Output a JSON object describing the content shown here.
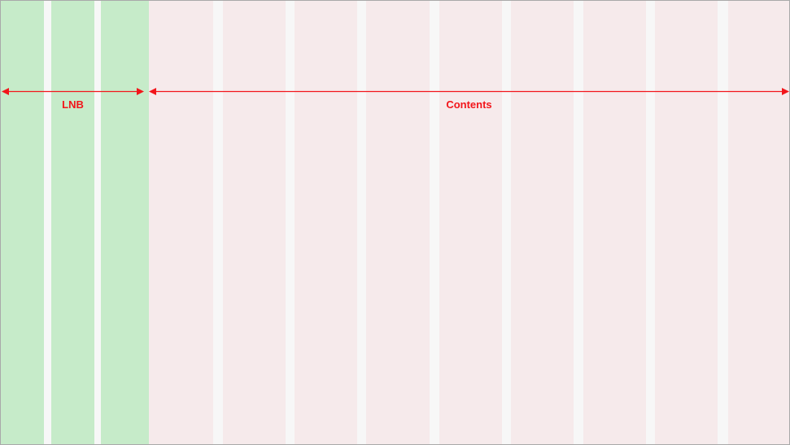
{
  "regions": {
    "lnb": {
      "label": "LNB",
      "color": "#c6ebc9",
      "columns": 3
    },
    "contents": {
      "label": "Contents",
      "color": "#f6eaeb",
      "columns": 9
    }
  },
  "colors": {
    "gutter": "#f7f7f7",
    "annotation": "#f2161b",
    "border": "#a9a9a9"
  }
}
